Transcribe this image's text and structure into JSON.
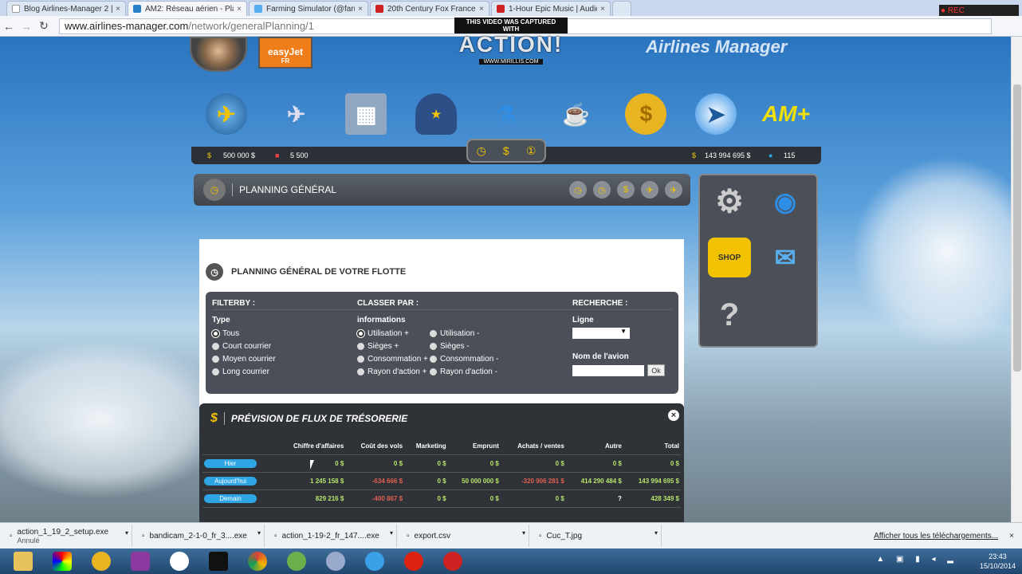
{
  "browser": {
    "tabs": [
      {
        "label": "Blog Airlines-Manager 2 |",
        "color": "#ffffff"
      },
      {
        "label": "AM2: Réseau aérien - Plan",
        "color": "#2a80c8"
      },
      {
        "label": "Farming Simulator (@farm",
        "color": "#55acee"
      },
      {
        "label": "20th Century Fox France -",
        "color": "#cc2222"
      },
      {
        "label": "1-Hour Epic Music | Audic",
        "color": "#cc2222"
      }
    ],
    "url_domain": "www.airlines-manager.com",
    "url_path": "/network/generalPlanning/1"
  },
  "capture": {
    "line1": "THIS VIDEO WAS CAPTURED WITH",
    "logo": "ACTION!",
    "site": "WWW.MIRILLIS.COM"
  },
  "brand": "Airlines Manager",
  "airline": {
    "name": "easyJet",
    "country": "FR"
  },
  "status": {
    "budget": "500 000 $",
    "points": "5 500",
    "cash": "143 994 695 $",
    "credits": "115"
  },
  "planning": {
    "title": "PLANNING GÉNÉRAL",
    "subtitle": "PLANNING GÉNÉRAL DE VOTRE FLOTTE"
  },
  "filter": {
    "filterby": "FILTERBY :",
    "type_label": "Type",
    "types": [
      "Tous",
      "Court courrier",
      "Moyen courrier",
      "Long courrier"
    ],
    "classer": "CLASSER PAR :",
    "info_label": "informations",
    "sort_left": [
      "Utilisation +",
      "Sièges +",
      "Consommation +",
      "Rayon d'action +"
    ],
    "sort_right": [
      "Utilisation -",
      "Sièges -",
      "Consommation -",
      "Rayon d'action -"
    ],
    "recherche": "RECHERCHE :",
    "ligne": "Ligne",
    "ligne_value": "▼",
    "nom": "Nom de l'avion",
    "nom_value": "",
    "ok": "Ok"
  },
  "cashflow": {
    "title": "PRÉVISION DE FLUX DE TRÉSORERIE",
    "columns": [
      "",
      "Chiffre d'affaires",
      "Coût des vols",
      "Marketing",
      "Emprunt",
      "Achats / ventes",
      "Autre",
      "Total"
    ],
    "rows": [
      {
        "label": "Hier",
        "values": [
          "0 $",
          "0 $",
          "0 $",
          "0 $",
          "0 $",
          "0 $",
          "0 $"
        ]
      },
      {
        "label": "Aujourd'hui",
        "values": [
          "1 245 158 $",
          "-634 666 $",
          "0 $",
          "50 000 000 $",
          "-320 906 281 $",
          "414 290 484 $",
          "143 994 695 $"
        ]
      },
      {
        "label": "Demain",
        "values": [
          "829 216 $",
          "-400 867 $",
          "0 $",
          "0 $",
          "0 $",
          "?",
          "428 349 $"
        ]
      }
    ]
  },
  "sidebar": {
    "shop": "SHOP",
    "help": "?"
  },
  "downloads": {
    "items": [
      {
        "name": "action_1_19_2_setup.exe",
        "status": "Annulé"
      },
      {
        "name": "bandicam_2-1-0_fr_3....exe",
        "status": ""
      },
      {
        "name": "action_1-19-2_fr_147....exe",
        "status": ""
      },
      {
        "name": "export.csv",
        "status": ""
      },
      {
        "name": "Cuc_T.jpg",
        "status": ""
      }
    ],
    "show_all": "Afficher tous les téléchargements..."
  },
  "taskbar": {
    "time": "23:43",
    "date": "15/10/2014"
  }
}
